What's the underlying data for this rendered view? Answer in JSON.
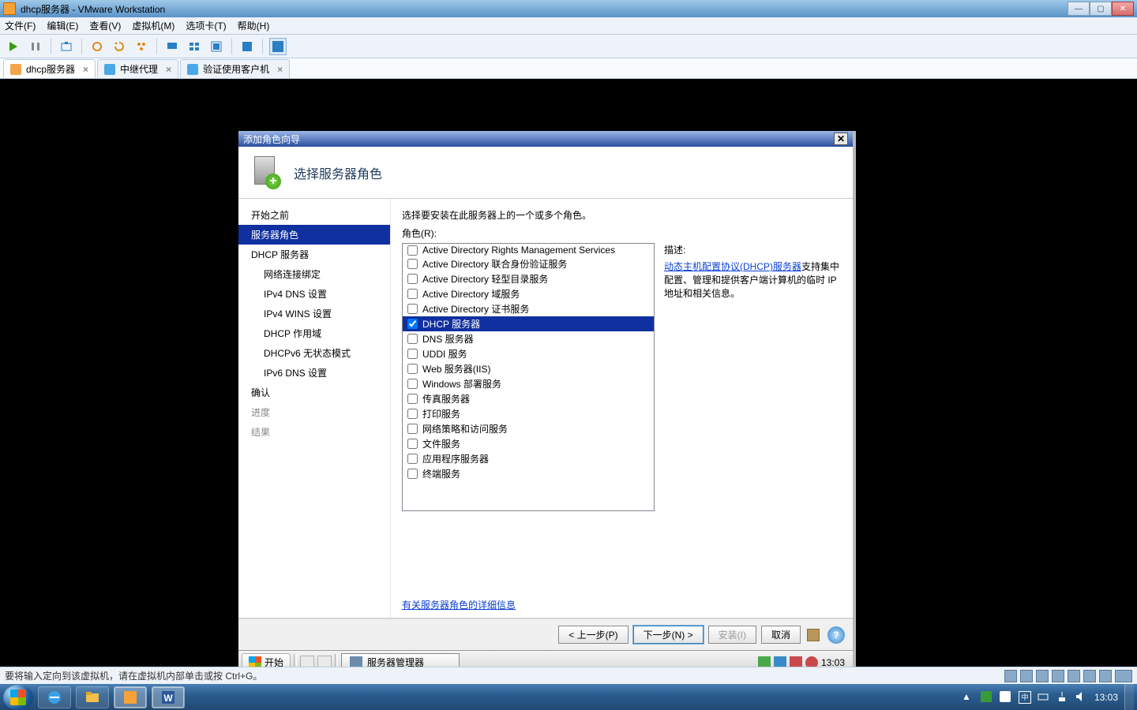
{
  "host_title": "dhcp服务器 - VMware Workstation",
  "menubar": [
    "文件(F)",
    "编辑(E)",
    "查看(V)",
    "虚拟机(M)",
    "选项卡(T)",
    "帮助(H)"
  ],
  "vm_tabs": [
    {
      "label": "dhcp服务器",
      "active": true,
      "color": "#f2a54a"
    },
    {
      "label": "中继代理",
      "active": false,
      "color": "#4aa8e8"
    },
    {
      "label": "验证使用客户机",
      "active": false,
      "color": "#4aa8e8"
    }
  ],
  "wizard": {
    "title": "添加角色向导",
    "header": "选择服务器角色",
    "nav": [
      {
        "label": "开始之前",
        "sel": false
      },
      {
        "label": "服务器角色",
        "sel": true
      },
      {
        "label": "DHCP 服务器",
        "sel": false
      },
      {
        "label": "网络连接绑定",
        "sel": false,
        "sub": true
      },
      {
        "label": "IPv4 DNS 设置",
        "sel": false,
        "sub": true
      },
      {
        "label": "IPv4 WINS 设置",
        "sel": false,
        "sub": true
      },
      {
        "label": "DHCP 作用域",
        "sel": false,
        "sub": true
      },
      {
        "label": "DHCPv6 无状态模式",
        "sel": false,
        "sub": true
      },
      {
        "label": "IPv6 DNS 设置",
        "sel": false,
        "sub": true
      },
      {
        "label": "确认",
        "sel": false
      },
      {
        "label": "进度",
        "sel": false,
        "dim": true
      },
      {
        "label": "结果",
        "sel": false,
        "dim": true
      }
    ],
    "intro_line": "选择要安装在此服务器上的一个或多个角色。",
    "roles_label": "角色(R):",
    "roles": [
      {
        "label": "Active Directory Rights Management Services",
        "checked": false
      },
      {
        "label": "Active Directory 联合身份验证服务",
        "checked": false
      },
      {
        "label": "Active Directory 轻型目录服务",
        "checked": false
      },
      {
        "label": "Active Directory 域服务",
        "checked": false
      },
      {
        "label": "Active Directory 证书服务",
        "checked": false
      },
      {
        "label": "DHCP 服务器",
        "checked": true,
        "sel": true
      },
      {
        "label": "DNS 服务器",
        "checked": false
      },
      {
        "label": "UDDI 服务",
        "checked": false
      },
      {
        "label": "Web 服务器(IIS)",
        "checked": false
      },
      {
        "label": "Windows 部署服务",
        "checked": false
      },
      {
        "label": "传真服务器",
        "checked": false
      },
      {
        "label": "打印服务",
        "checked": false
      },
      {
        "label": "网络策略和访问服务",
        "checked": false
      },
      {
        "label": "文件服务",
        "checked": false
      },
      {
        "label": "应用程序服务器",
        "checked": false
      },
      {
        "label": "终端服务",
        "checked": false
      }
    ],
    "desc_heading": "描述:",
    "desc_link": "动态主机配置协议(DHCP)服务器",
    "desc_rest": "支持集中配置、管理和提供客户端计算机的临时 IP 地址和相关信息。",
    "more_link": "有关服务器角色的详细信息",
    "buttons": {
      "prev": "< 上一步(P)",
      "next": "下一步(N) >",
      "install": "安装(I)",
      "cancel": "取消"
    }
  },
  "guest_taskbar": {
    "start": "开始",
    "task": "服务器管理器",
    "clock": "13:03"
  },
  "host_status": "要将输入定向到该虚拟机，请在虚拟机内部单击或按 Ctrl+G。",
  "host_clock": "13:03"
}
